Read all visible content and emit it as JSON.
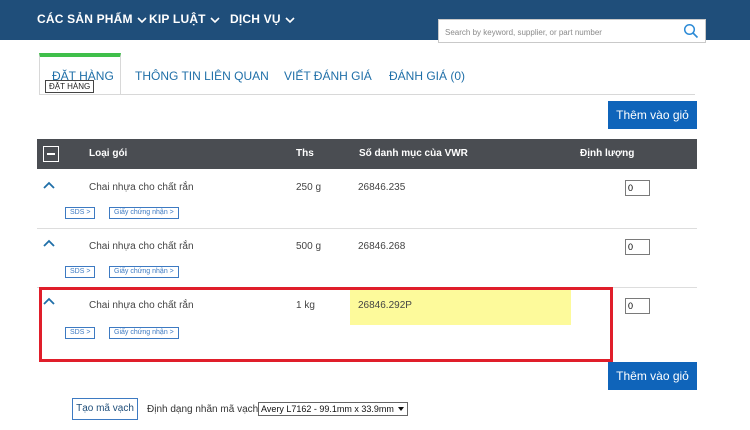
{
  "nav": {
    "items": [
      "CÁC SẢN PHẨM",
      "KIP LUẬT",
      "DỊCH VỤ"
    ],
    "search_placeholder": "Search by keyword, supplier, or part number"
  },
  "tabs": {
    "items": [
      "ĐẶT HÀNG",
      "THÔNG TIN LIÊN QUAN",
      "VIẾT ĐÁNH GIÁ",
      "ĐÁNH GIÁ (0)"
    ],
    "tooltip": "ĐẶT HÀNG"
  },
  "actions": {
    "add_to_cart": "Thêm vào giỏ"
  },
  "table": {
    "headers": [
      "Loại gói",
      "Ths",
      "Số danh mục của VWR",
      "Định lượng"
    ],
    "rows": [
      {
        "name": "Chai nhựa cho chất rắn",
        "size": "250 g",
        "catalog": "26846.235",
        "qty": "0",
        "sds": "SDS",
        "cert": "Giấy chứng nhận"
      },
      {
        "name": "Chai nhựa cho chất rắn",
        "size": "500 g",
        "catalog": "26846.268",
        "qty": "0",
        "sds": "SDS",
        "cert": "Giấy chứng nhận"
      },
      {
        "name": "Chai nhựa cho chất rắn",
        "size": "1 kg",
        "catalog": "26846.292P",
        "qty": "0",
        "sds": "SDS",
        "cert": "Giấy chứng nhận"
      }
    ]
  },
  "barcode": {
    "button": "Tạo mã vạch",
    "label": "Định dạng nhãn mã vạch:",
    "selected": "Avery L7162 - 99.1mm x 33.9mm"
  },
  "colors": {
    "nav_bg": "#1f4e7a",
    "primary_button": "#0f64ba",
    "table_header": "#4a4d52",
    "active_tab": "#3fbf4a",
    "highlight": "#fdfa9b",
    "annotation_red": "#e01e2a"
  }
}
